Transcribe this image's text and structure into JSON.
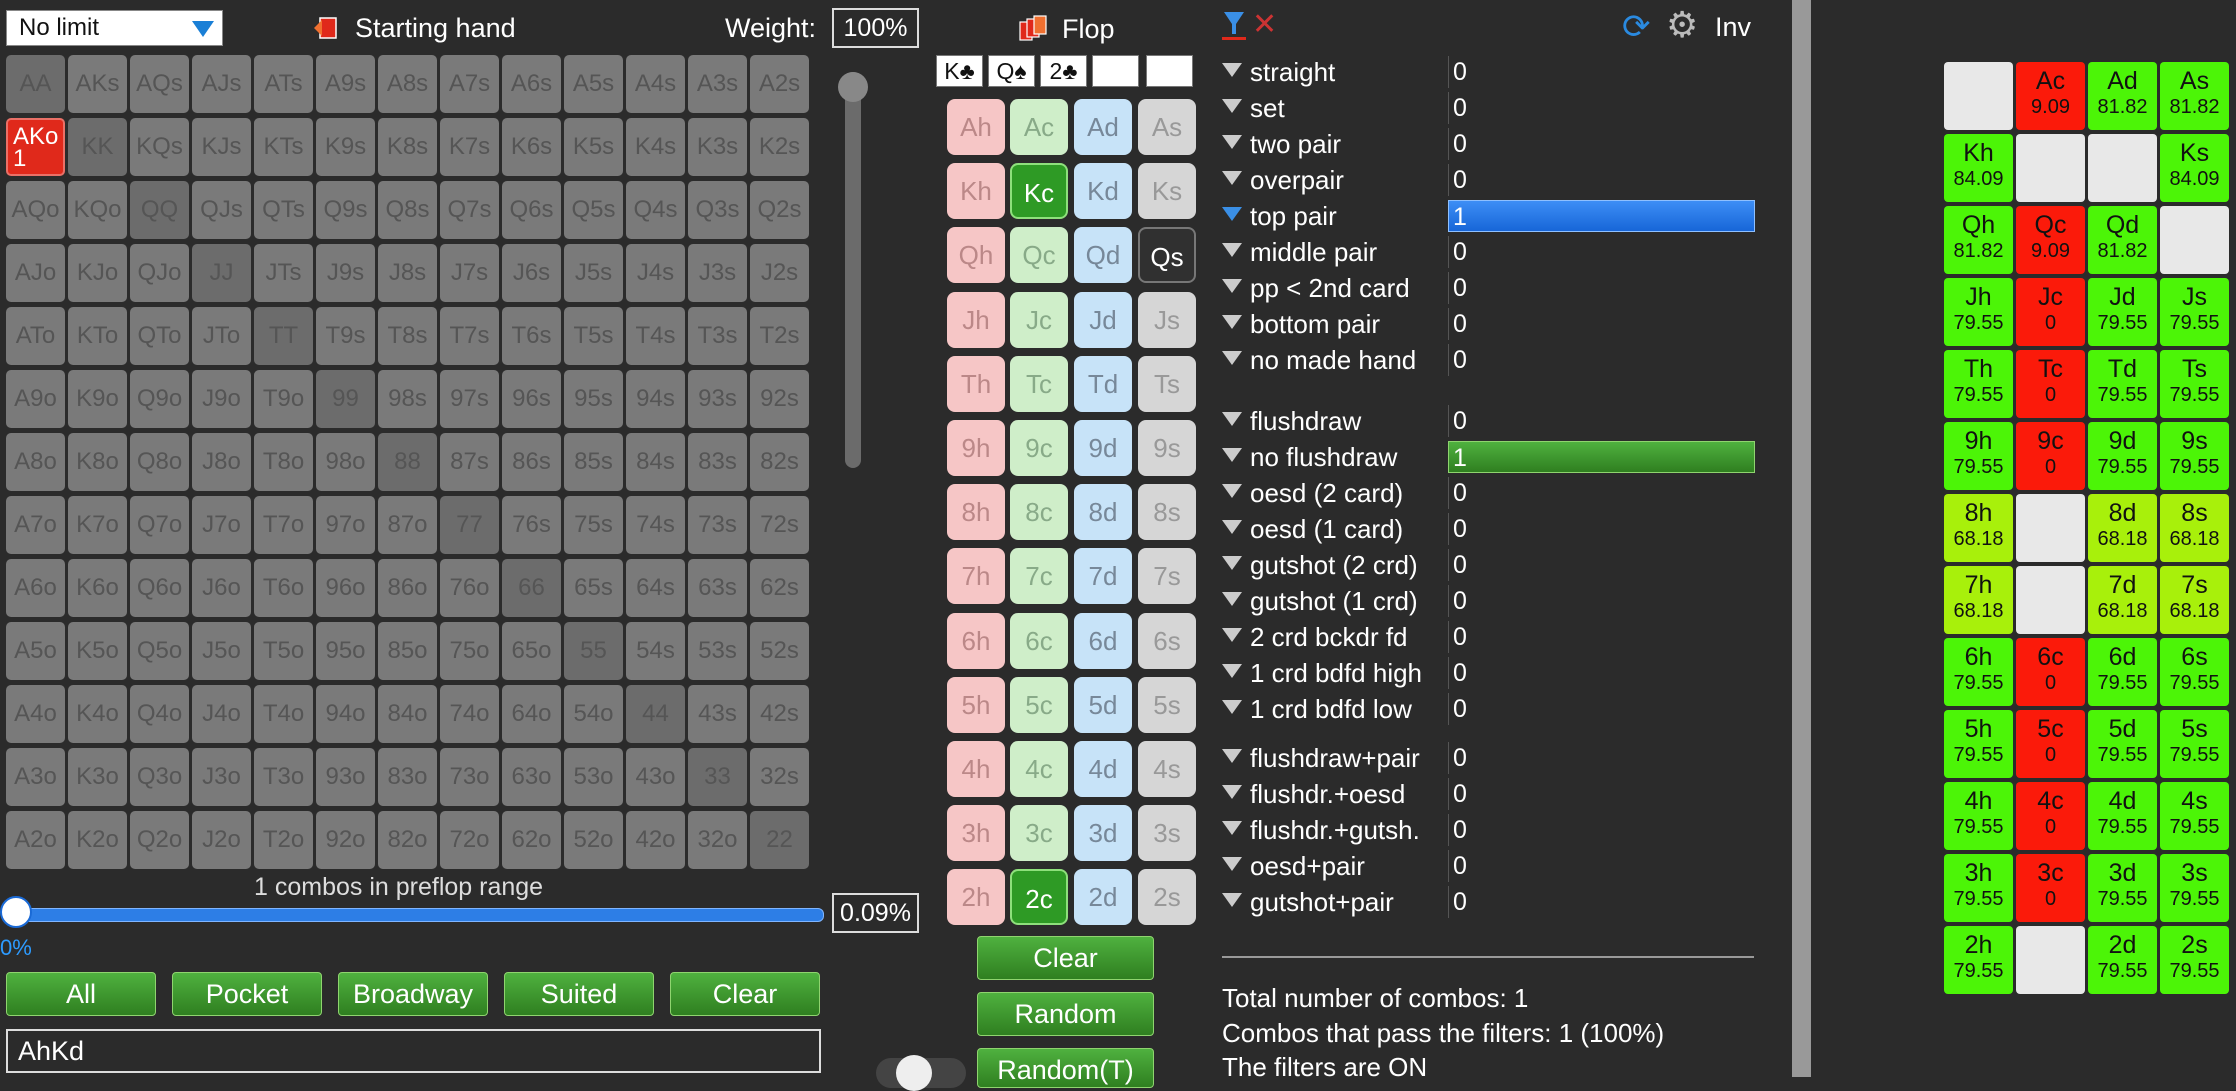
{
  "limit_select": {
    "value": "No limit"
  },
  "starting_hand": {
    "label": "Starting hand"
  },
  "weight": {
    "label": "Weight:",
    "value": "100%"
  },
  "matrix": {
    "rows": [
      [
        "AA",
        "AKs",
        "AQs",
        "AJs",
        "ATs",
        "A9s",
        "A8s",
        "A7s",
        "A6s",
        "A5s",
        "A4s",
        "A3s",
        "A2s"
      ],
      [
        "AKo",
        "KK",
        "KQs",
        "KJs",
        "KTs",
        "K9s",
        "K8s",
        "K7s",
        "K6s",
        "K5s",
        "K4s",
        "K3s",
        "K2s"
      ],
      [
        "AQo",
        "KQo",
        "QQ",
        "QJs",
        "QTs",
        "Q9s",
        "Q8s",
        "Q7s",
        "Q6s",
        "Q5s",
        "Q4s",
        "Q3s",
        "Q2s"
      ],
      [
        "AJo",
        "KJo",
        "QJo",
        "JJ",
        "JTs",
        "J9s",
        "J8s",
        "J7s",
        "J6s",
        "J5s",
        "J4s",
        "J3s",
        "J2s"
      ],
      [
        "ATo",
        "KTo",
        "QTo",
        "JTo",
        "TT",
        "T9s",
        "T8s",
        "T7s",
        "T6s",
        "T5s",
        "T4s",
        "T3s",
        "T2s"
      ],
      [
        "A9o",
        "K9o",
        "Q9o",
        "J9o",
        "T9o",
        "99",
        "98s",
        "97s",
        "96s",
        "95s",
        "94s",
        "93s",
        "92s"
      ],
      [
        "A8o",
        "K8o",
        "Q8o",
        "J8o",
        "T8o",
        "98o",
        "88",
        "87s",
        "86s",
        "85s",
        "84s",
        "83s",
        "82s"
      ],
      [
        "A7o",
        "K7o",
        "Q7o",
        "J7o",
        "T7o",
        "97o",
        "87o",
        "77",
        "76s",
        "75s",
        "74s",
        "73s",
        "72s"
      ],
      [
        "A6o",
        "K6o",
        "Q6o",
        "J6o",
        "T6o",
        "96o",
        "86o",
        "76o",
        "66",
        "65s",
        "64s",
        "63s",
        "62s"
      ],
      [
        "A5o",
        "K5o",
        "Q5o",
        "J5o",
        "T5o",
        "95o",
        "85o",
        "75o",
        "65o",
        "55",
        "54s",
        "53s",
        "52s"
      ],
      [
        "A4o",
        "K4o",
        "Q4o",
        "J4o",
        "T4o",
        "94o",
        "84o",
        "74o",
        "64o",
        "54o",
        "44",
        "43s",
        "42s"
      ],
      [
        "A3o",
        "K3o",
        "Q3o",
        "J3o",
        "T3o",
        "93o",
        "83o",
        "73o",
        "63o",
        "53o",
        "43o",
        "33",
        "32s"
      ],
      [
        "A2o",
        "K2o",
        "Q2o",
        "J2o",
        "T2o",
        "92o",
        "82o",
        "72o",
        "62o",
        "52o",
        "42o",
        "32o",
        "22"
      ]
    ],
    "selected": {
      "hand": "AKo",
      "count": "1"
    }
  },
  "range": {
    "combos_text": "1 combos in preflop range",
    "slider_percent": "0%",
    "percent_box": "0.09%"
  },
  "buttons": {
    "all": "All",
    "pocket": "Pocket",
    "broadway": "Broadway",
    "suited": "Suited",
    "clear": "Clear"
  },
  "hand_input": {
    "value": "AhKd"
  },
  "flop": {
    "label": "Flop",
    "board": [
      "K♣",
      "Q♠",
      "2♣",
      "",
      ""
    ],
    "cards": [
      [
        "Ah",
        "Ac",
        "Ad",
        "As"
      ],
      [
        "Kh",
        "Kc",
        "Kd",
        "Ks"
      ],
      [
        "Qh",
        "Qc",
        "Qd",
        "Qs"
      ],
      [
        "Jh",
        "Jc",
        "Jd",
        "Js"
      ],
      [
        "Th",
        "Tc",
        "Td",
        "Ts"
      ],
      [
        "9h",
        "9c",
        "9d",
        "9s"
      ],
      [
        "8h",
        "8c",
        "8d",
        "8s"
      ],
      [
        "7h",
        "7c",
        "7d",
        "7s"
      ],
      [
        "6h",
        "6c",
        "6d",
        "6s"
      ],
      [
        "5h",
        "5c",
        "5d",
        "5s"
      ],
      [
        "4h",
        "4c",
        "4d",
        "4s"
      ],
      [
        "3h",
        "3c",
        "3d",
        "3s"
      ],
      [
        "2h",
        "2c",
        "2d",
        "2s"
      ]
    ],
    "selected_cards": [
      "Kc",
      "Qs",
      "2c"
    ],
    "clear": "Clear",
    "random": "Random",
    "random_t": "Random(T)"
  },
  "toolbar": {
    "inv": "Inv"
  },
  "filters": {
    "groups": [
      [
        {
          "name": "straight",
          "value": "0"
        },
        {
          "name": "set",
          "value": "0"
        },
        {
          "name": "two pair",
          "value": "0"
        },
        {
          "name": "overpair",
          "value": "0"
        },
        {
          "name": "top pair",
          "value": "1",
          "hl": "blue"
        },
        {
          "name": "middle pair",
          "value": "0"
        },
        {
          "name": "pp < 2nd card",
          "value": "0"
        },
        {
          "name": "bottom pair",
          "value": "0"
        },
        {
          "name": "no made hand",
          "value": "0"
        }
      ],
      [
        {
          "name": "flushdraw",
          "value": "0"
        },
        {
          "name": "no flushdraw",
          "value": "1",
          "hl": "green"
        },
        {
          "name": "oesd (2 card)",
          "value": "0"
        },
        {
          "name": "oesd (1 card)",
          "value": "0"
        },
        {
          "name": "gutshot (2 crd)",
          "value": "0"
        },
        {
          "name": "gutshot (1 crd)",
          "value": "0"
        },
        {
          "name": "2 crd bckdr fd",
          "value": "0"
        },
        {
          "name": "1 crd bdfd high",
          "value": "0"
        },
        {
          "name": "1 crd bdfd low",
          "value": "0"
        }
      ],
      [
        {
          "name": "flushdraw+pair",
          "value": "0"
        },
        {
          "name": "flushdr.+oesd",
          "value": "0"
        },
        {
          "name": "flushdr.+gutsh.",
          "value": "0"
        },
        {
          "name": "oesd+pair",
          "value": "0"
        },
        {
          "name": "gutshot+pair",
          "value": "0"
        }
      ]
    ]
  },
  "summary": {
    "total": "Total number of combos: 1",
    "pass": "Combos that pass the filters: 1 (100%)",
    "state": "The filters are ON"
  },
  "equity_grid": [
    [
      {
        "c": "",
        "v": "",
        "k": "empty"
      },
      {
        "c": "Ac",
        "v": "9.09",
        "k": "red"
      },
      {
        "c": "Ad",
        "v": "81.82",
        "k": "grn"
      },
      {
        "c": "As",
        "v": "81.82",
        "k": "grn"
      }
    ],
    [
      {
        "c": "Kh",
        "v": "84.09",
        "k": "grn"
      },
      {
        "c": "",
        "v": "",
        "k": "empty"
      },
      {
        "c": "",
        "v": "",
        "k": "empty"
      },
      {
        "c": "Ks",
        "v": "84.09",
        "k": "grn"
      }
    ],
    [
      {
        "c": "Qh",
        "v": "81.82",
        "k": "grn"
      },
      {
        "c": "Qc",
        "v": "9.09",
        "k": "red"
      },
      {
        "c": "Qd",
        "v": "81.82",
        "k": "grn"
      },
      {
        "c": "",
        "v": "",
        "k": "empty"
      }
    ],
    [
      {
        "c": "Jh",
        "v": "79.55",
        "k": "grn"
      },
      {
        "c": "Jc",
        "v": "0",
        "k": "red"
      },
      {
        "c": "Jd",
        "v": "79.55",
        "k": "grn"
      },
      {
        "c": "Js",
        "v": "79.55",
        "k": "grn"
      }
    ],
    [
      {
        "c": "Th",
        "v": "79.55",
        "k": "grn"
      },
      {
        "c": "Tc",
        "v": "0",
        "k": "red"
      },
      {
        "c": "Td",
        "v": "79.55",
        "k": "grn"
      },
      {
        "c": "Ts",
        "v": "79.55",
        "k": "grn"
      }
    ],
    [
      {
        "c": "9h",
        "v": "79.55",
        "k": "grn"
      },
      {
        "c": "9c",
        "v": "0",
        "k": "red"
      },
      {
        "c": "9d",
        "v": "79.55",
        "k": "grn"
      },
      {
        "c": "9s",
        "v": "79.55",
        "k": "grn"
      }
    ],
    [
      {
        "c": "8h",
        "v": "68.18",
        "k": "lgr"
      },
      {
        "c": "",
        "v": "",
        "k": "empty"
      },
      {
        "c": "8d",
        "v": "68.18",
        "k": "lgr"
      },
      {
        "c": "8s",
        "v": "68.18",
        "k": "lgr"
      }
    ],
    [
      {
        "c": "7h",
        "v": "68.18",
        "k": "lgr"
      },
      {
        "c": "",
        "v": "",
        "k": "empty"
      },
      {
        "c": "7d",
        "v": "68.18",
        "k": "lgr"
      },
      {
        "c": "7s",
        "v": "68.18",
        "k": "lgr"
      }
    ],
    [
      {
        "c": "6h",
        "v": "79.55",
        "k": "grn"
      },
      {
        "c": "6c",
        "v": "0",
        "k": "red"
      },
      {
        "c": "6d",
        "v": "79.55",
        "k": "grn"
      },
      {
        "c": "6s",
        "v": "79.55",
        "k": "grn"
      }
    ],
    [
      {
        "c": "5h",
        "v": "79.55",
        "k": "grn"
      },
      {
        "c": "5c",
        "v": "0",
        "k": "red"
      },
      {
        "c": "5d",
        "v": "79.55",
        "k": "grn"
      },
      {
        "c": "5s",
        "v": "79.55",
        "k": "grn"
      }
    ],
    [
      {
        "c": "4h",
        "v": "79.55",
        "k": "grn"
      },
      {
        "c": "4c",
        "v": "0",
        "k": "red"
      },
      {
        "c": "4d",
        "v": "79.55",
        "k": "grn"
      },
      {
        "c": "4s",
        "v": "79.55",
        "k": "grn"
      }
    ],
    [
      {
        "c": "3h",
        "v": "79.55",
        "k": "grn"
      },
      {
        "c": "3c",
        "v": "0",
        "k": "red"
      },
      {
        "c": "3d",
        "v": "79.55",
        "k": "grn"
      },
      {
        "c": "3s",
        "v": "79.55",
        "k": "grn"
      }
    ],
    [
      {
        "c": "2h",
        "v": "79.55",
        "k": "grn"
      },
      {
        "c": "",
        "v": "",
        "k": "empty"
      },
      {
        "c": "2d",
        "v": "79.55",
        "k": "grn"
      },
      {
        "c": "2s",
        "v": "79.55",
        "k": "grn"
      }
    ]
  ],
  "colors": {
    "accent_blue": "#1a7fd6",
    "button_green": "#3a9a2d",
    "selected_red": "#e0291b"
  }
}
